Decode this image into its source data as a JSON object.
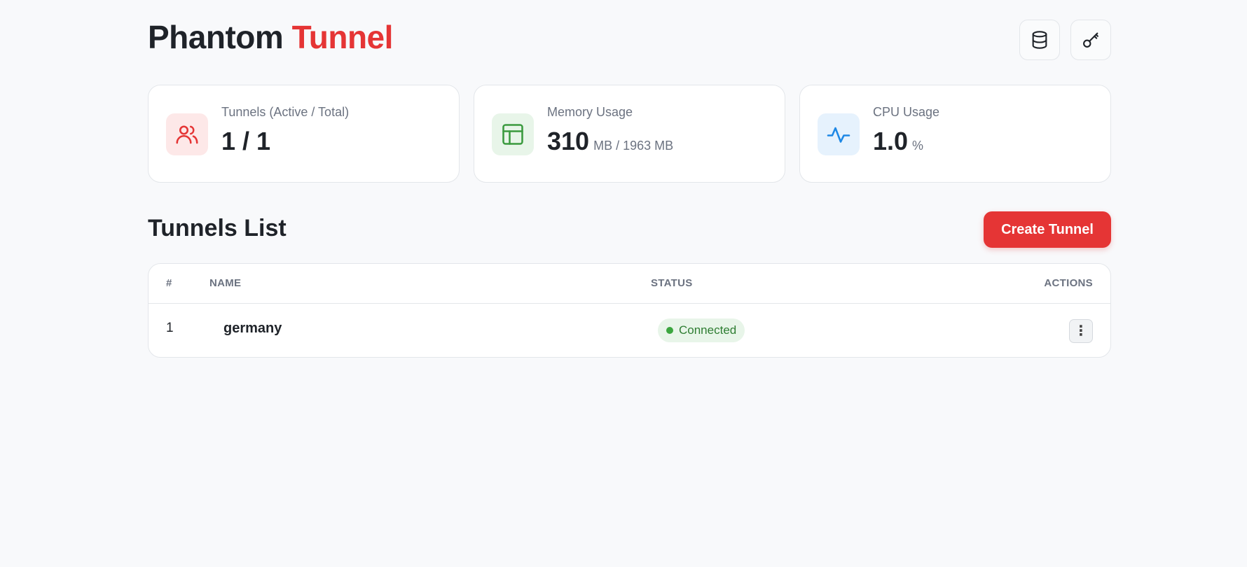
{
  "brand": {
    "part1": "Phantom",
    "part2": "Tunnel"
  },
  "header": {
    "buttons": [
      {
        "icon": "database-icon"
      },
      {
        "icon": "key-icon"
      }
    ]
  },
  "stats": [
    {
      "label": "Tunnels (Active / Total)",
      "value": "1 / 1",
      "unit": "",
      "icon": "users-icon",
      "color": "#e53535",
      "bg": "#fde8e8"
    },
    {
      "label": "Memory Usage",
      "value": "310",
      "unit": "MB / 1963 MB",
      "icon": "table-icon",
      "color": "#3a9a3e",
      "bg": "#e8f5e9"
    },
    {
      "label": "CPU Usage",
      "value": "1.0",
      "unit": "%",
      "icon": "activity-icon",
      "color": "#1e88e5",
      "bg": "#e6f2fd"
    }
  ],
  "section": {
    "title": "Tunnels List",
    "create_label": "Create Tunnel"
  },
  "table": {
    "headers": {
      "num": "#",
      "name": "NAME",
      "status": "STATUS",
      "actions": "ACTIONS"
    },
    "rows": [
      {
        "num": "1",
        "name": "germany",
        "status": "Connected"
      }
    ]
  },
  "colors": {
    "accent": "#e53535",
    "success": "#2e7d32"
  }
}
